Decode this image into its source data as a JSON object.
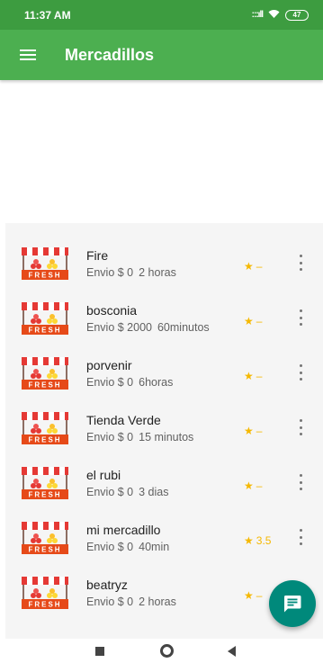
{
  "status_bar": {
    "time": "11:37 AM",
    "signal": ":::ıll",
    "wifi_icon": "wifi-icon",
    "battery": "47"
  },
  "app_bar": {
    "title": "Mercadillos",
    "menu_icon": "hamburger-menu-icon"
  },
  "stores": [
    {
      "name": "Fire",
      "shipping": "Envio $ 0",
      "time": "2 horas",
      "rating": "–"
    },
    {
      "name": "bosconia",
      "shipping": "Envio $ 2000",
      "time": "60minutos",
      "rating": "–"
    },
    {
      "name": "porvenir",
      "shipping": "Envio $ 0",
      "time": "6horas",
      "rating": "–"
    },
    {
      "name": "Tienda Verde",
      "shipping": "Envio $ 0",
      "time": "15 minutos",
      "rating": "–"
    },
    {
      "name": "el rubi",
      "shipping": "Envio $ 0",
      "time": "3 dias",
      "rating": "–"
    },
    {
      "name": "mi mercadillo",
      "shipping": "Envio $ 0",
      "time": "40min",
      "rating": "3.5"
    },
    {
      "name": "beatryz",
      "shipping": "Envio $ 0",
      "time": "2 horas",
      "rating": "–"
    }
  ],
  "thumbnail_label": "FRESH",
  "fab": {
    "icon": "message-icon"
  },
  "nav": {
    "recents_icon": "square-icon",
    "home_icon": "circle-icon",
    "back_icon": "triangle-back-icon"
  },
  "colors": {
    "status_bar": "#3d9c40",
    "app_bar": "#4caf50",
    "fab": "#00897b",
    "star": "#f5b800"
  }
}
